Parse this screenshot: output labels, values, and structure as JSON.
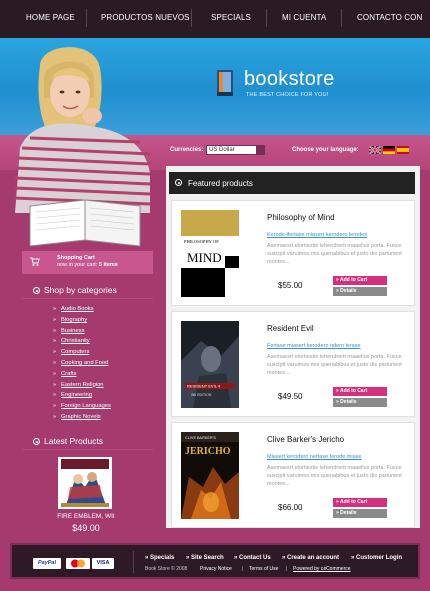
{
  "nav": {
    "items": [
      "HOME PAGE",
      "PRODUCTOS NUEVOS",
      "SPECIALS",
      "MI CUENTA",
      "CONTACTO CON"
    ]
  },
  "logo": {
    "name": "bookstore",
    "slogan": "THE BEST CHOICE FOR YOU!"
  },
  "currency": {
    "label": "Currencies:",
    "selected": "US Dollar"
  },
  "language": {
    "label": "Choose your language:",
    "flags": [
      "uk-flag",
      "germany-flag",
      "spain-flag"
    ]
  },
  "cart": {
    "title": "Shopping Cart",
    "sub_prefix": "now in your cart",
    "count": "5 items"
  },
  "categories": {
    "heading": "Shop by categories",
    "items": [
      "Audio Books",
      "Biography",
      "Business",
      "Christianity",
      "Computers",
      "Cooking and Food",
      "Crafts",
      "Eastern Religion",
      "Engineering",
      "Foreign Languages",
      "Graphic Novels"
    ]
  },
  "latest": {
    "heading": "Latest Products",
    "name": "FIRE EMBLEM, WII",
    "price": "$49.00"
  },
  "featured": {
    "heading": "Featured products",
    "products": [
      {
        "title": "Philosophy of Mind",
        "link": "Kerode-ifertase miasert kerodero lerodes",
        "desc": "Asemaesrt elortiestie lehendrerit maaellus porta. Fusce suscipit varuimos mis quenabibus et justo dis parturient montes...",
        "price": "$55.00",
        "add": "Add to Cart",
        "details": "Details",
        "cover_lines": [
          "PHILOSOPHY OF",
          "MIND"
        ]
      },
      {
        "title": "Resident Evil",
        "link": "Fertase miasert kerodero odero lerase",
        "desc": "Asemaesrt elortiestie lehendrerit maaellus porta. Fusce suscipit varuimos mis quenabibus et justo dis parturient montes...",
        "price": "$49.50",
        "add": "Add to Cart",
        "details": "Details",
        "cover_lines": [
          "RESIDENT EVIL 4",
          "WII EDITION"
        ]
      },
      {
        "title": "Clive Barker's Jericho",
        "link": "Miasert kerodero nertase ferode miase",
        "desc": "Asemaesrt elortiestie lehendrerit maaellus porta. Fusce suscipit varuimos mis quenabibus et justo dis parturient montes...",
        "price": "$66.00",
        "add": "Add to Cart",
        "details": "Details",
        "cover_lines": [
          "CLIVE BARKER'S",
          "JERICHO"
        ]
      }
    ]
  },
  "footer": {
    "payments": [
      "PayPal",
      "MasterCard",
      "VISA"
    ],
    "links": [
      "Specials",
      "Site Search",
      "Contact Us",
      "Create an account",
      "Customer Login"
    ],
    "copyright": "Book Store © 2008",
    "privacy": "Privacy Notice",
    "terms": "Terms of Use",
    "powered": "Powered by osCommerce"
  },
  "colors": {
    "pink": "#a43a6e",
    "blue": "#2aa5df",
    "dark": "#2a1a24",
    "button_pink": "#d6307c",
    "link_blue": "#3a8fd6"
  }
}
